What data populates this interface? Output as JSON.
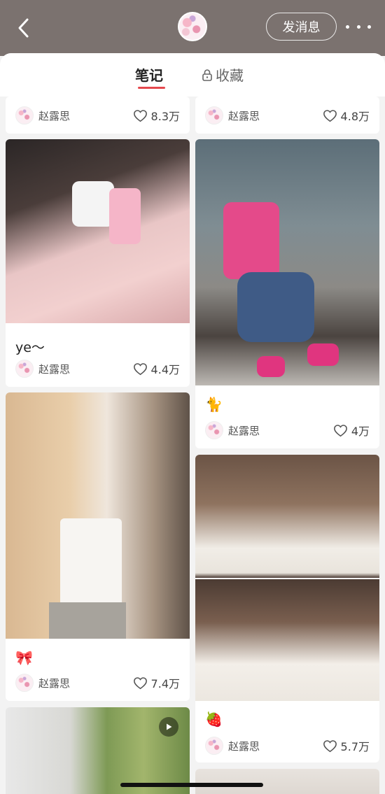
{
  "header": {
    "back_label": "‹",
    "message_button": "发消息",
    "more_label": "more"
  },
  "tabs": [
    {
      "label": "笔记",
      "active": true
    },
    {
      "label": "收藏",
      "locked": true
    }
  ],
  "feed": {
    "left": [
      {
        "caption": "",
        "author": "赵露思",
        "likes": "8.3万"
      },
      {
        "caption": "ye～",
        "author": "赵露思",
        "likes": "4.4万"
      },
      {
        "caption": "🎀",
        "author": "赵露思",
        "likes": "7.4万"
      },
      {
        "caption": "",
        "author": "",
        "likes": "",
        "video": true
      }
    ],
    "right": [
      {
        "caption": "",
        "author": "赵露思",
        "likes": "4.8万"
      },
      {
        "caption": "🐈",
        "author": "赵露思",
        "likes": "4万"
      },
      {
        "caption": "🍓",
        "author": "赵露思",
        "likes": "5.7万"
      }
    ]
  },
  "colors": {
    "header_bg": "#7b726f",
    "accent": "#e5484d",
    "page_bg": "#f3f3f3"
  }
}
